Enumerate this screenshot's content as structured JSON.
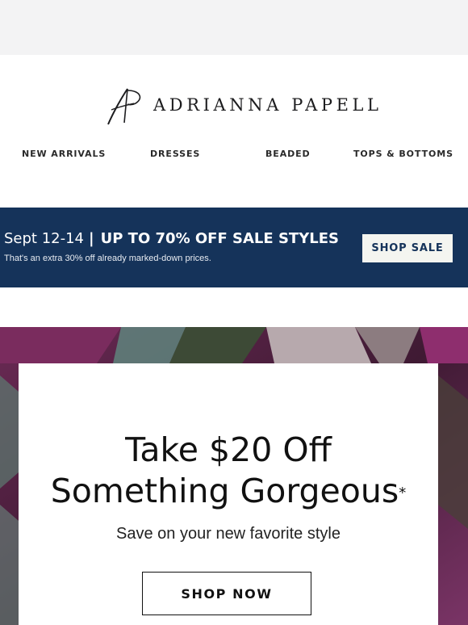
{
  "header": {
    "brand_name": "ADRIANNA PAPELL",
    "logo_monogram": "AP"
  },
  "nav": {
    "items": [
      {
        "label": "NEW ARRIVALS"
      },
      {
        "label": "DRESSES"
      },
      {
        "label": "BEADED"
      },
      {
        "label": "TOPS & BOTTOMS"
      }
    ]
  },
  "banner": {
    "dates": "Sept 12-14",
    "separator": "|",
    "headline": "UP TO 70% OFF SALE STYLES",
    "subtext": "That's an extra 30% off already marked-down prices.",
    "cta_label": "SHOP SALE",
    "background_color": "#15335a"
  },
  "hero": {
    "headline_line1": "Take $20 Off",
    "headline_line2": "Something Gorgeous",
    "asterisk": "*",
    "subhead": "Save on your new favorite style",
    "cta_label": "SHOP NOW"
  }
}
